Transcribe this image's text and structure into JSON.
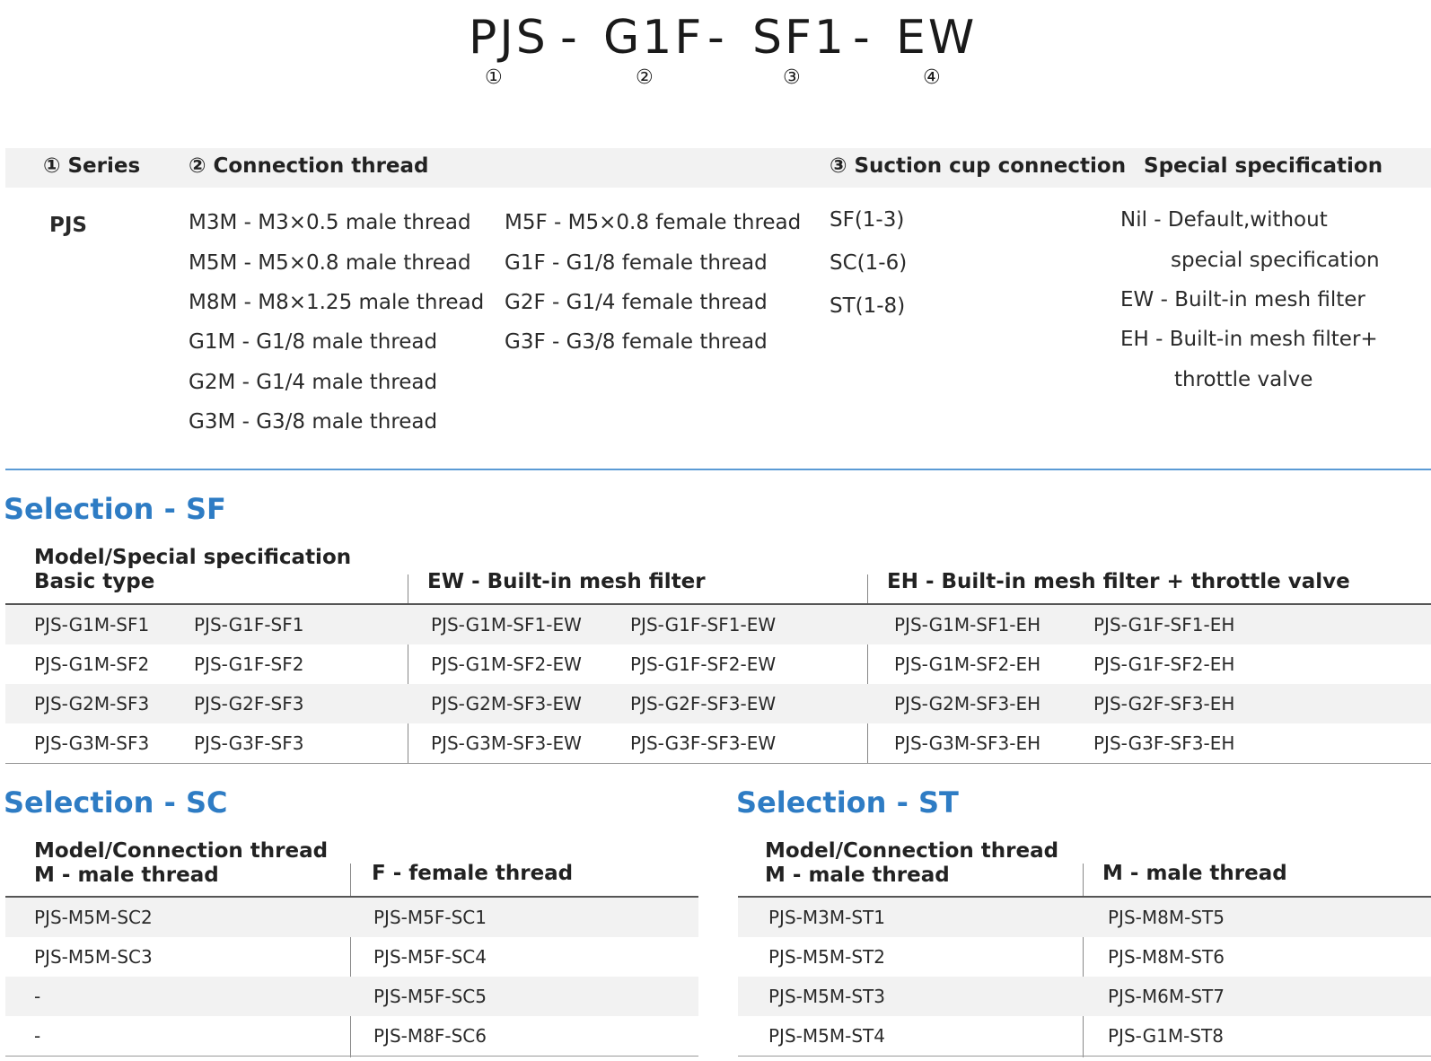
{
  "code": {
    "parts": [
      "PJS",
      "G1F",
      "SF1",
      "EW"
    ],
    "separator": "-",
    "markers": [
      "①",
      "②",
      "③",
      "④"
    ]
  },
  "ordering": {
    "headers": {
      "series": "① Series",
      "thread": "② Connection thread",
      "suction": "③ Suction cup connection",
      "special": "Special specification"
    },
    "series_value": "PJS",
    "male_threads": [
      "M3M - M3×0.5 male thread",
      "M5M - M5×0.8 male thread",
      "M8M - M8×1.25 male thread",
      "G1M  - G1/8 male thread",
      "G2M  - G1/4 male thread",
      "G3M  - G3/8 male thread"
    ],
    "female_threads": [
      "M5F - M5×0.8 female thread",
      "G1F  - G1/8 female thread",
      "G2F  - G1/4 female thread",
      "G3F  - G3/8 female thread"
    ],
    "suction_options": [
      "SF(1-3)",
      "SC(1-6)",
      "ST(1-8)"
    ],
    "special": {
      "nil_line1": "Nil - Default,without",
      "nil_line2": "special specification",
      "ew": "EW - Built-in mesh filter",
      "eh_line1": "EH  - Built-in mesh filter+",
      "eh_line2": "throttle valve"
    }
  },
  "selection_sf": {
    "title": "Selection - SF",
    "header_basic_line1": "Model/Special specification",
    "header_basic_line2": "Basic type",
    "header_ew": "EW - Built-in mesh filter",
    "header_eh": "EH - Built-in mesh filter + throttle valve",
    "rows": [
      [
        "PJS-G1M-SF1",
        "PJS-G1F-SF1",
        "PJS-G1M-SF1-EW",
        "PJS-G1F-SF1-EW",
        "PJS-G1M-SF1-EH",
        "PJS-G1F-SF1-EH"
      ],
      [
        "PJS-G1M-SF2",
        "PJS-G1F-SF2",
        "PJS-G1M-SF2-EW",
        "PJS-G1F-SF2-EW",
        "PJS-G1M-SF2-EH",
        "PJS-G1F-SF2-EH"
      ],
      [
        "PJS-G2M-SF3",
        "PJS-G2F-SF3",
        "PJS-G2M-SF3-EW",
        "PJS-G2F-SF3-EW",
        "PJS-G2M-SF3-EH",
        "PJS-G2F-SF3-EH"
      ],
      [
        "PJS-G3M-SF3",
        "PJS-G3F-SF3",
        "PJS-G3M-SF3-EW",
        "PJS-G3F-SF3-EW",
        "PJS-G3M-SF3-EH",
        "PJS-G3F-SF3-EH"
      ]
    ]
  },
  "selection_sc": {
    "title": "Selection - SC",
    "header_left_line1": "Model/Connection thread",
    "header_left_line2": "M - male thread",
    "header_right": "F - female thread",
    "rows": [
      [
        "PJS-M5M-SC2",
        "PJS-M5F-SC1"
      ],
      [
        "PJS-M5M-SC3",
        "PJS-M5F-SC4"
      ],
      [
        "-",
        "PJS-M5F-SC5"
      ],
      [
        "-",
        "PJS-M8F-SC6"
      ]
    ]
  },
  "selection_st": {
    "title": "Selection - ST",
    "header_left_line1": "Model/Connection thread",
    "header_left_line2": "M - male thread",
    "header_right": "M - male thread",
    "rows": [
      [
        "PJS-M3M-ST1",
        "PJS-M8M-ST5"
      ],
      [
        "PJS-M5M-ST2",
        "PJS-M8M-ST6"
      ],
      [
        "PJS-M5M-ST3",
        "PJS-M6M-ST7"
      ],
      [
        "PJS-M5M-ST4",
        "PJS-G1M-ST8"
      ]
    ]
  }
}
